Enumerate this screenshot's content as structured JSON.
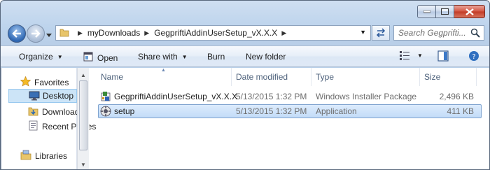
{
  "window": {
    "controls": {
      "minimize": "minimize",
      "maximize": "maximize",
      "close": "close"
    }
  },
  "address": {
    "crumbs": [
      "myDownloads",
      "GegpriftiAddinUserSetup_vX.X.X"
    ],
    "search_placeholder": "Search Gegprifti..."
  },
  "toolbar": {
    "organize": "Organize",
    "open": "Open",
    "share_with": "Share with",
    "burn": "Burn",
    "new_folder": "New folder"
  },
  "navpane": {
    "favorites": "Favorites",
    "items": [
      "Desktop",
      "Downloads",
      "Recent Places"
    ],
    "libraries": "Libraries"
  },
  "columns": {
    "name": "Name",
    "date_modified": "Date modified",
    "type": "Type",
    "size": "Size"
  },
  "files": [
    {
      "name": "GegpriftiAddinUserSetup_vX.X.X",
      "date": "5/13/2015 1:32 PM",
      "type": "Windows Installer Package",
      "size": "2,496 KB"
    },
    {
      "name": "setup",
      "date": "5/13/2015 1:32 PM",
      "type": "Application",
      "size": "411 KB"
    }
  ],
  "colors": {
    "selection": "#c3dcf8",
    "selection_border": "#7da2ce",
    "chrome": "#bcd3ec"
  }
}
